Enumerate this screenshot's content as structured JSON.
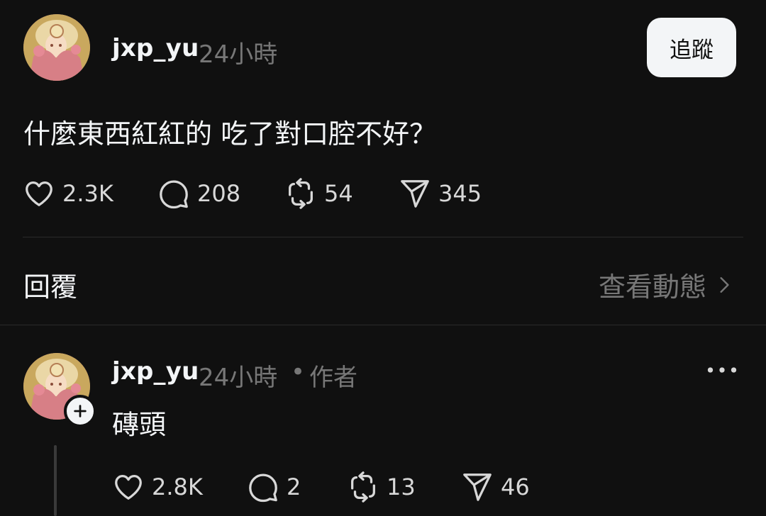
{
  "post": {
    "username": "jxp_yu",
    "time": "24小時",
    "follow_label": "追蹤",
    "text": "什麼東西紅紅的 吃了對口腔不好？",
    "stats": {
      "likes": "2.3K",
      "comments": "208",
      "reposts": "54",
      "shares": "345"
    }
  },
  "replies_header": {
    "label": "回覆",
    "activity_link": "查看動態"
  },
  "reply": {
    "username": "jxp_yu",
    "time": "24小時",
    "separator": "•",
    "author_tag": "作者",
    "text": "磚頭",
    "stats": {
      "likes": "2.8K",
      "comments": "2",
      "reposts": "13",
      "shares": "46"
    }
  },
  "icons": {
    "like": "heart-icon",
    "comment": "comment-bubble-icon",
    "repost": "repost-icon",
    "share": "send-icon",
    "more": "more-dots-icon",
    "activity": "chevron-right-icon",
    "add": "plus-icon"
  }
}
